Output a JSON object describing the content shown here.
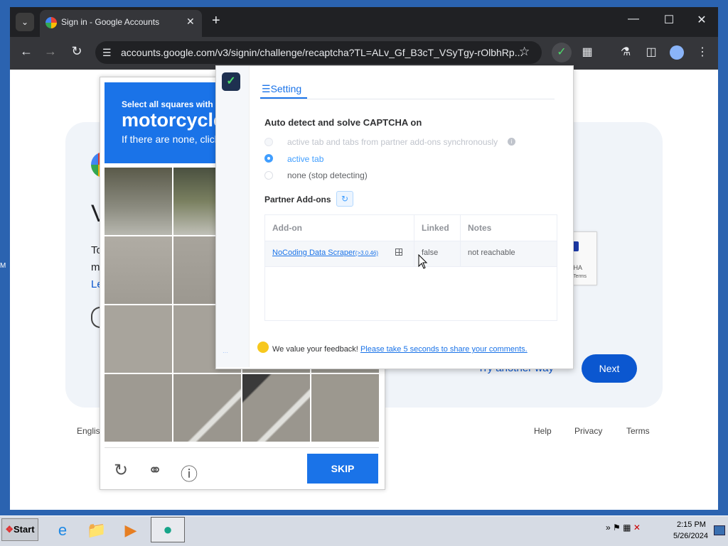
{
  "browser": {
    "tab_title": "Sign in - Google Accounts",
    "new_tab_symbol": "+",
    "url": "accounts.google.com/v3/signin/challenge/recaptcha?TL=ALv_Gf_B3cT_VSyTgy-rOlbhRp...",
    "icons": [
      "tab-dropdown-icon",
      "close-icon",
      "minimize-icon",
      "maximize-icon",
      "back-icon",
      "forward-icon",
      "reload-icon",
      "site-info-icon",
      "bookmark-star-icon",
      "extension-icon",
      "puzzle-icon",
      "labs-icon",
      "side-panel-icon",
      "profile-icon",
      "menu-icon"
    ]
  },
  "page": {
    "card_partial_v": "V",
    "card_partial_t": "To",
    "card_partial_m": "m",
    "card_partial_l": "Le",
    "try_another_way": "Try another way",
    "next_label": "Next",
    "lang_partial": "Englis",
    "footer": {
      "help": "Help",
      "privacy": "Privacy",
      "terms": "Terms"
    },
    "recaptcha_badge_text": "CHA",
    "recaptcha_badge_terms": "Terms"
  },
  "challenge": {
    "line1": "Select all squares with",
    "target": "motorcycles",
    "line3": "If there are none, click skip",
    "skip_label": "SKIP",
    "icons": [
      "reload-icon",
      "headphones-icon",
      "info-icon"
    ]
  },
  "popup": {
    "tab_label": "Setting",
    "auto_detect_title": "Auto detect and solve CAPTCHA on",
    "options": [
      {
        "label": "active tab and tabs from partner add-ons synchronously",
        "state": "disabled"
      },
      {
        "label": "active tab",
        "state": "selected"
      },
      {
        "label": "none (stop detecting)",
        "state": "unselected"
      }
    ],
    "partner_title": "Partner Add-ons",
    "table": {
      "headers": [
        "Add-on",
        "Linked",
        "Notes"
      ],
      "rows": [
        {
          "addon": "NoCoding Data Scraper",
          "version": "(>3.0.46)",
          "linked": "false",
          "notes": "not reachable"
        }
      ]
    },
    "feedback_text": "We value your feedback!",
    "feedback_link": "Please take 5 seconds to share your comments.",
    "accent_color": "#409eff"
  },
  "taskbar": {
    "start_label": "Start",
    "time": "2:15 PM",
    "date": "5/26/2024",
    "tray_chevron": "»"
  }
}
